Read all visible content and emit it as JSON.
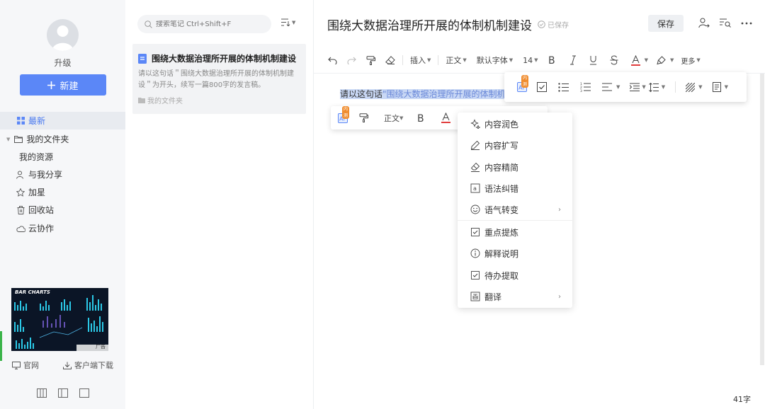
{
  "sidebar": {
    "upgrade": "升级",
    "new_label": "新建",
    "nav": [
      {
        "label": "最新",
        "icon": "grid-icon",
        "active": true
      },
      {
        "label": "我的文件夹",
        "icon": "folder-icon"
      },
      {
        "label": "我的资源",
        "icon": ""
      },
      {
        "label": "与我分享",
        "icon": "share-user-icon"
      },
      {
        "label": "加星",
        "icon": "star-icon"
      },
      {
        "label": "回收站",
        "icon": "trash-icon"
      },
      {
        "label": "云协作",
        "icon": "cloud-icon"
      }
    ],
    "ad_text": "BAR CHARTS",
    "ad_close": "广告",
    "footer": {
      "website": "官网",
      "download": "客户端下载"
    }
  },
  "notelist": {
    "search_placeholder": "搜索笔记 Ctrl+Shift+F",
    "note": {
      "title": "围绕大数据治理所开展的体制机制建设",
      "snippet": "请以这句话＂围绕大数据治理所开展的体制机制建设＂为开头，续写一篇800字的发言稿。",
      "folder": "我的文件夹"
    }
  },
  "editor": {
    "title": "围绕大数据治理所开展的体制机制建设",
    "saved_status": "已保存",
    "save_label": "保存",
    "toolbar": {
      "insert": "插入",
      "paragraph": "正文",
      "font": "默认字体",
      "size": "14",
      "more": "更多"
    },
    "selected_text_a": "请以这句话",
    "selected_text_b": "\"围绕大数据治理所开展的体制机",
    "floatbar2": {
      "paragraph": "正文"
    },
    "ai_badge": "AI",
    "badge_new": "内测",
    "menu": [
      {
        "label": "内容润色",
        "icon": "sparkle-icon"
      },
      {
        "label": "内容扩写",
        "icon": "pen-icon"
      },
      {
        "label": "内容精简",
        "icon": "eraser-icon"
      },
      {
        "label": "语法纠错",
        "icon": "grammar-icon"
      },
      {
        "label": "语气转变",
        "icon": "smile-icon",
        "submenu": true
      },
      {
        "label": "重点提炼",
        "icon": "check-square-icon"
      },
      {
        "label": "解释说明",
        "icon": "info-icon"
      },
      {
        "label": "待办提取",
        "icon": "todo-icon"
      },
      {
        "label": "翻译",
        "icon": "translate-icon",
        "submenu": true
      }
    ],
    "word_count": "41字"
  },
  "colors": {
    "accent": "#5b87f7",
    "sidebar_bg": "#f6f7f9",
    "selection": "#c9d8f5",
    "badge": "#f08c2e"
  }
}
